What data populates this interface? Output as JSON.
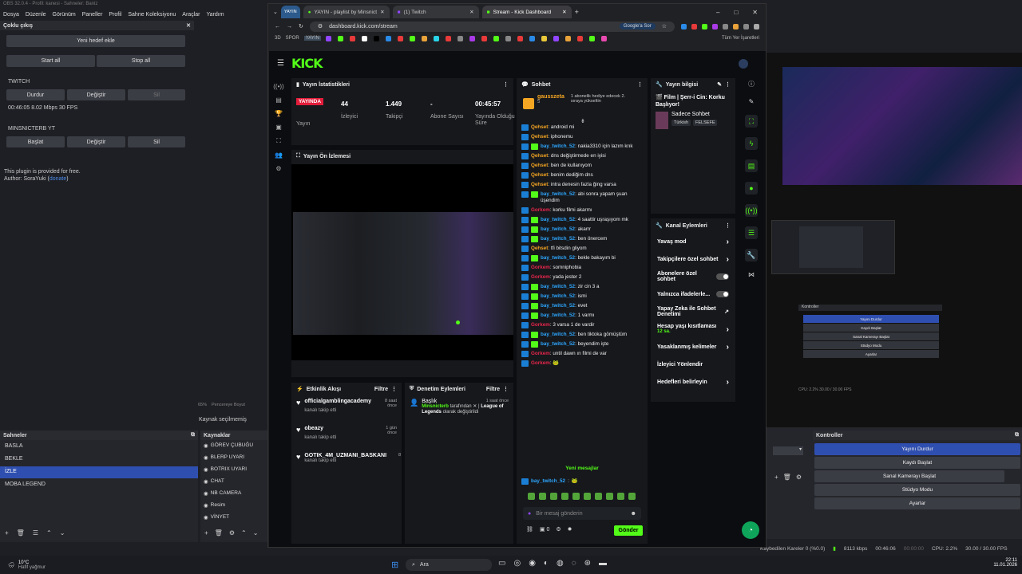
{
  "obs": {
    "title": "OBS 32.0.4 - Profil: kanesi - Sahneler: Baniz",
    "menu": [
      "Dosya",
      "Düzenle",
      "Görünüm",
      "Paneller",
      "Profil",
      "Sahne Koleksiyonu",
      "Araçlar",
      "Yardım"
    ],
    "multi_output": {
      "title": "Çoklu çıkış",
      "add_target": "Yeni hedef ekle",
      "start_all": "Start all",
      "stop_all": "Stop all",
      "twitch_label": "TWITCH",
      "twitch_buttons": [
        "Durdur",
        "Değiştir",
        "Sil"
      ],
      "twitch_stats": "00:46:05  8.02 Mbps  30 FPS",
      "yt_label": "MINSNICTERB YT",
      "yt_buttons": [
        "Başlat",
        "Değiştir",
        "Sil"
      ],
      "plugin_note": "This plugin is provided for free.",
      "author": "Author: SoraYuki (",
      "donate": "donate",
      "author_end": ")"
    },
    "zoom_bar": {
      "zoom": "65%",
      "label": "Pencereye Boyut"
    },
    "source_none": "Kaynak seçilmemiş",
    "scenes": {
      "title": "Sahneler",
      "items": [
        "BASLA",
        "BEKLE",
        "İZLE",
        "MOBA LEGEND"
      ],
      "selected": 2
    },
    "sources": {
      "title": "Kaynaklar",
      "items": [
        "GÖREV ÇUBUĞU",
        "BLERP UYARI",
        "BOTRIX UYARI",
        "CHAT",
        "NB CAMERA",
        "Resim",
        "VİNYET"
      ]
    },
    "controls": {
      "title": "Kontroller",
      "buttons": [
        "Yayını Durdur",
        "Kaydı Başlat",
        "Sanal Kamerayı Başlat",
        "Stüdyo Modu",
        "Ayarlar"
      ]
    },
    "statusbar": {
      "dropped": "Kaybedilen Kareler 0 (%0.0)",
      "bitrate": "8113 kbps",
      "live": "00:46:06",
      "rec": "00:00:00",
      "cpu": "CPU: 2.2%",
      "fps": "30.00 / 30.00 FPS"
    }
  },
  "browser": {
    "tabs": [
      "YAYIN",
      "YAYIN - playlist by Minsnicterb",
      "(1) Twitch",
      "Stream - Kick Dashboard"
    ],
    "url": "dashboard.kick.com/stream",
    "google_btn": "Google'a Sor",
    "bookmarks_lead": [
      "3D",
      "SPOR",
      "YAYIN"
    ],
    "bookmarks_end": "Tüm Yer İşaretleri"
  },
  "kick": {
    "logo": "KICK",
    "stats": {
      "title": "Yayın İstatistikleri",
      "live_badge": "YAYINDA",
      "items": [
        {
          "label": "Yayın",
          "value": ""
        },
        {
          "label": "İzleyici",
          "value": "44"
        },
        {
          "label": "Takipçi",
          "value": "1.449"
        },
        {
          "label": "Abone Sayısı",
          "value": "-"
        },
        {
          "label": "Yayında Olduğu Süre",
          "value": "00:45:57"
        }
      ]
    },
    "preview_title": "Yayın Ön İzlemesi",
    "activity": {
      "title": "Etkinlik Akışı",
      "filter": "Filtre",
      "items": [
        {
          "name": "officialgamblingacademy",
          "time": "8 saat önce",
          "sub": "kanalı takip etti"
        },
        {
          "name": "obeazy",
          "time": "1 gün önce",
          "sub": "kanalı takip etti"
        },
        {
          "name": "GOTIK_4M_UZMANI_BASKANI",
          "time": "8",
          "sub": "kanalı takip etti"
        }
      ]
    },
    "moderation": {
      "title": "Denetim Eylemleri",
      "filter": "Filtre",
      "item": {
        "title": "Başlık",
        "time": "1 saat önce",
        "user": "Minsnicterb",
        "text": "tarafından",
        "game": "League of Legends",
        "suffix": "olarak değiştirildi"
      }
    },
    "chat": {
      "title": "Sohbet",
      "pinned_user": "gausszeta",
      "pinned_count": "5",
      "pinned_note": "1 abonelik hediye edecek 2. sıraya yükseltin",
      "messages": [
        {
          "user": "Qehset",
          "color": "#f5a623",
          "text": "android mi"
        },
        {
          "user": "Qehset",
          "color": "#f5a623",
          "text": "iphonemu"
        },
        {
          "user": "bay_twitch_52",
          "color": "#2ea7ff",
          "text": "nakia3310 için lazım krık"
        },
        {
          "user": "Qehset",
          "color": "#f5a623",
          "text": "dns değiştirmede en iyisi"
        },
        {
          "user": "Qehset",
          "color": "#f5a623",
          "text": "ben de kullanıyom"
        },
        {
          "user": "Qehset",
          "color": "#f5a623",
          "text": "benim dediğim dns"
        },
        {
          "user": "Qehset",
          "color": "#f5a623",
          "text": "intra denesin fazla ğing varsa"
        },
        {
          "user": "bay_twitch_52",
          "color": "#2ea7ff",
          "text": "abi sonra yapam şuan üşendim"
        },
        {
          "user": "Gorkem",
          "color": "#e8264b",
          "text": "korku filmi akarmı"
        },
        {
          "user": "bay_twitch_52",
          "color": "#2ea7ff",
          "text": "4 saattir uşraşıyom mk"
        },
        {
          "user": "bay_twitch_52",
          "color": "#2ea7ff",
          "text": "akarrr"
        },
        {
          "user": "bay_twitch_52",
          "color": "#2ea7ff",
          "text": "ben önercem"
        },
        {
          "user": "Qehset",
          "color": "#f5a623",
          "text": "tfi bitsdin gliyom"
        },
        {
          "user": "bay_twitch_52",
          "color": "#2ea7ff",
          "text": "bekle bakayım bi"
        },
        {
          "user": "Gorkem",
          "color": "#e8264b",
          "text": "somniphobia"
        },
        {
          "user": "Gorkem",
          "color": "#e8264b",
          "text": "yada jester 2"
        },
        {
          "user": "bay_twitch_52",
          "color": "#2ea7ff",
          "text": "zir cin 3 a"
        },
        {
          "user": "bay_twitch_52",
          "color": "#2ea7ff",
          "text": "ismi"
        },
        {
          "user": "bay_twitch_52",
          "color": "#2ea7ff",
          "text": "evet"
        },
        {
          "user": "bay_twitch_52",
          "color": "#2ea7ff",
          "text": "1 varmı"
        },
        {
          "user": "Gorkem",
          "color": "#e8264b",
          "text": "3 varsa 1 de vardir"
        },
        {
          "user": "bay_twitch_52",
          "color": "#2ea7ff",
          "text": "ben tiktoka gömüştüm"
        },
        {
          "user": "bay_twitch_52",
          "color": "#2ea7ff",
          "text": "beyendim işte"
        },
        {
          "user": "Gorkem",
          "color": "#e8264b",
          "text": "until dawn ın filmi de var"
        },
        {
          "user": "Gorkem",
          "color": "#e8264b",
          "text": "🐸"
        }
      ],
      "new_messages": "Yeni mesajlar",
      "last_message": {
        "user": "bay_twitch_52",
        "color": "#2ea7ff",
        "text": "🐸"
      },
      "input_placeholder": "Bir mesaj gönderin",
      "count": "0",
      "send": "Gönder"
    },
    "info": {
      "title": "Yayın bilgisi",
      "stream_title": "🎬 Film | Şerr-i Cin: Korku Başlıyor!",
      "category": "Sadece Sohbet",
      "tags": [
        "Türkish",
        "FELSEFE"
      ]
    },
    "channel_actions": {
      "title": "Kanal Eylemleri",
      "rows": [
        {
          "label": "Yavaş mod",
          "type": "arrow"
        },
        {
          "label": "Takipçilere özel sohbet",
          "type": "arrow"
        },
        {
          "label": "Abonelere özel sohbet",
          "type": "toggle"
        },
        {
          "label": "Yalnızca ifadelerle...",
          "type": "toggle"
        },
        {
          "label": "Yapay Zeka ile Sohbet Denetimi",
          "type": "ext"
        },
        {
          "label": "Hesap yaşı kısıtlaması",
          "sub": "12 sa.",
          "type": "arrow"
        },
        {
          "label": "Yasaklanmış kelimeler",
          "type": "arrow"
        },
        {
          "label": "İzleyici Yönlendir",
          "type": "none"
        },
        {
          "label": "Hedefleri belirleyin",
          "type": "arrow"
        }
      ]
    }
  },
  "second_obs": {
    "controls_title": "Kontroller",
    "buttons": [
      "Yayını Durdur",
      "Kaydı Başlat",
      "Sanal Kamerayı Başlat",
      "Stüdyo Modu",
      "Ayarlar"
    ]
  },
  "taskbar": {
    "weather_temp": "10°C",
    "weather_desc": "Hafif yağmur",
    "search": "Ara",
    "time": "22:11",
    "date": "11.01.2026"
  }
}
